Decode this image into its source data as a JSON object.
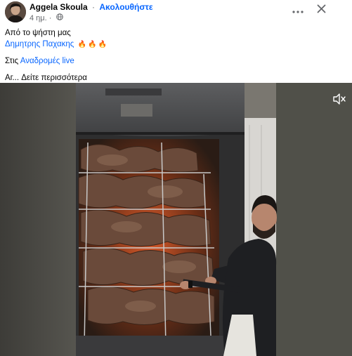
{
  "post": {
    "author": "Aggela Skoula",
    "separator": "·",
    "follow_label": "Ακολουθήστε",
    "time": "4 ημ.",
    "meta_separator": "·"
  },
  "caption": {
    "text": "Από το ψήστη μας",
    "tagged_name": "Δημητρης Παχακης",
    "group_prefix": "Στις",
    "group_name": "Αναδρομές live",
    "truncated_text": "Αг...",
    "see_more_label": "Δείτε περισσότερα"
  },
  "icons": {
    "globe": "globe-icon",
    "more": "more-horizontal-icon",
    "close": "close-icon",
    "mute": "speaker-muted-icon",
    "fire": "fire-emoji"
  },
  "colors": {
    "link": "#0866ff",
    "secondary_text": "#65676b",
    "video_background": "#4d4c48"
  }
}
